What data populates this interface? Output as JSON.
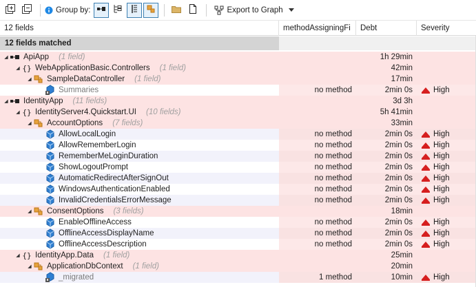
{
  "toolbar": {
    "group_by_label": "Group by:",
    "export_label": "Export to Graph",
    "info_icon": "info-icon",
    "colors": {
      "accent": "#3c7fb1",
      "info": "#1e88e5"
    }
  },
  "columns": {
    "name": "12 fields",
    "method": "methodAssigningFi",
    "debt": "Debt",
    "severity": "Severity"
  },
  "matched_label": "12 fields matched",
  "rows": [
    {
      "level": 0,
      "type": "assembly",
      "name": "ApiApp",
      "count": "(1 field)",
      "debt": "1h  29min"
    },
    {
      "level": 1,
      "type": "namespace",
      "name": "WebApplicationBasic.Controllers",
      "count": "(1 field)",
      "debt": "42min"
    },
    {
      "level": 2,
      "type": "class",
      "name": "SampleDataController",
      "count": "(1 field)",
      "debt": "17min"
    },
    {
      "level": 3,
      "type": "field",
      "name": "Summaries",
      "grey": true,
      "method": "no method",
      "debt": "2min  0s",
      "severity": "High"
    },
    {
      "level": 0,
      "type": "assembly",
      "name": "IdentityApp",
      "count": "(11 fields)",
      "debt": "3d  3h"
    },
    {
      "level": 1,
      "type": "namespace",
      "name": "IdentityServer4.Quickstart.UI",
      "count": "(10 fields)",
      "debt": "5h  41min"
    },
    {
      "level": 2,
      "type": "class",
      "name": "AccountOptions",
      "count": "(7 fields)",
      "debt": "33min"
    },
    {
      "level": 3,
      "type": "field",
      "name": "AllowLocalLogin",
      "method": "no method",
      "debt": "2min  0s",
      "severity": "High"
    },
    {
      "level": 3,
      "type": "field",
      "name": "AllowRememberLogin",
      "method": "no method",
      "debt": "2min  0s",
      "severity": "High"
    },
    {
      "level": 3,
      "type": "field",
      "name": "RememberMeLoginDuration",
      "method": "no method",
      "debt": "2min  0s",
      "severity": "High"
    },
    {
      "level": 3,
      "type": "field",
      "name": "ShowLogoutPrompt",
      "method": "no method",
      "debt": "2min  0s",
      "severity": "High"
    },
    {
      "level": 3,
      "type": "field",
      "name": "AutomaticRedirectAfterSignOut",
      "method": "no method",
      "debt": "2min  0s",
      "severity": "High"
    },
    {
      "level": 3,
      "type": "field",
      "name": "WindowsAuthenticationEnabled",
      "method": "no method",
      "debt": "2min  0s",
      "severity": "High"
    },
    {
      "level": 3,
      "type": "field",
      "name": "InvalidCredentialsErrorMessage",
      "method": "no method",
      "debt": "2min  0s",
      "severity": "High"
    },
    {
      "level": 2,
      "type": "class",
      "name": "ConsentOptions",
      "count": "(3 fields)",
      "debt": "18min"
    },
    {
      "level": 3,
      "type": "field",
      "name": "EnableOfflineAccess",
      "method": "no method",
      "debt": "2min  0s",
      "severity": "High"
    },
    {
      "level": 3,
      "type": "field",
      "name": "OfflineAccessDisplayName",
      "method": "no method",
      "debt": "2min  0s",
      "severity": "High"
    },
    {
      "level": 3,
      "type": "field",
      "name": "OfflineAccessDescription",
      "method": "no method",
      "debt": "2min  0s",
      "severity": "High"
    },
    {
      "level": 1,
      "type": "namespace",
      "name": "IdentityApp.Data",
      "count": "(1 field)",
      "debt": "25min"
    },
    {
      "level": 2,
      "type": "class",
      "name": "ApplicationDbContext",
      "count": "(1 field)",
      "debt": "20min"
    },
    {
      "level": 3,
      "type": "field",
      "name": "_migrated",
      "grey": true,
      "method": "1 method",
      "debt": "10min",
      "severity": "High",
      "selected": true
    }
  ]
}
